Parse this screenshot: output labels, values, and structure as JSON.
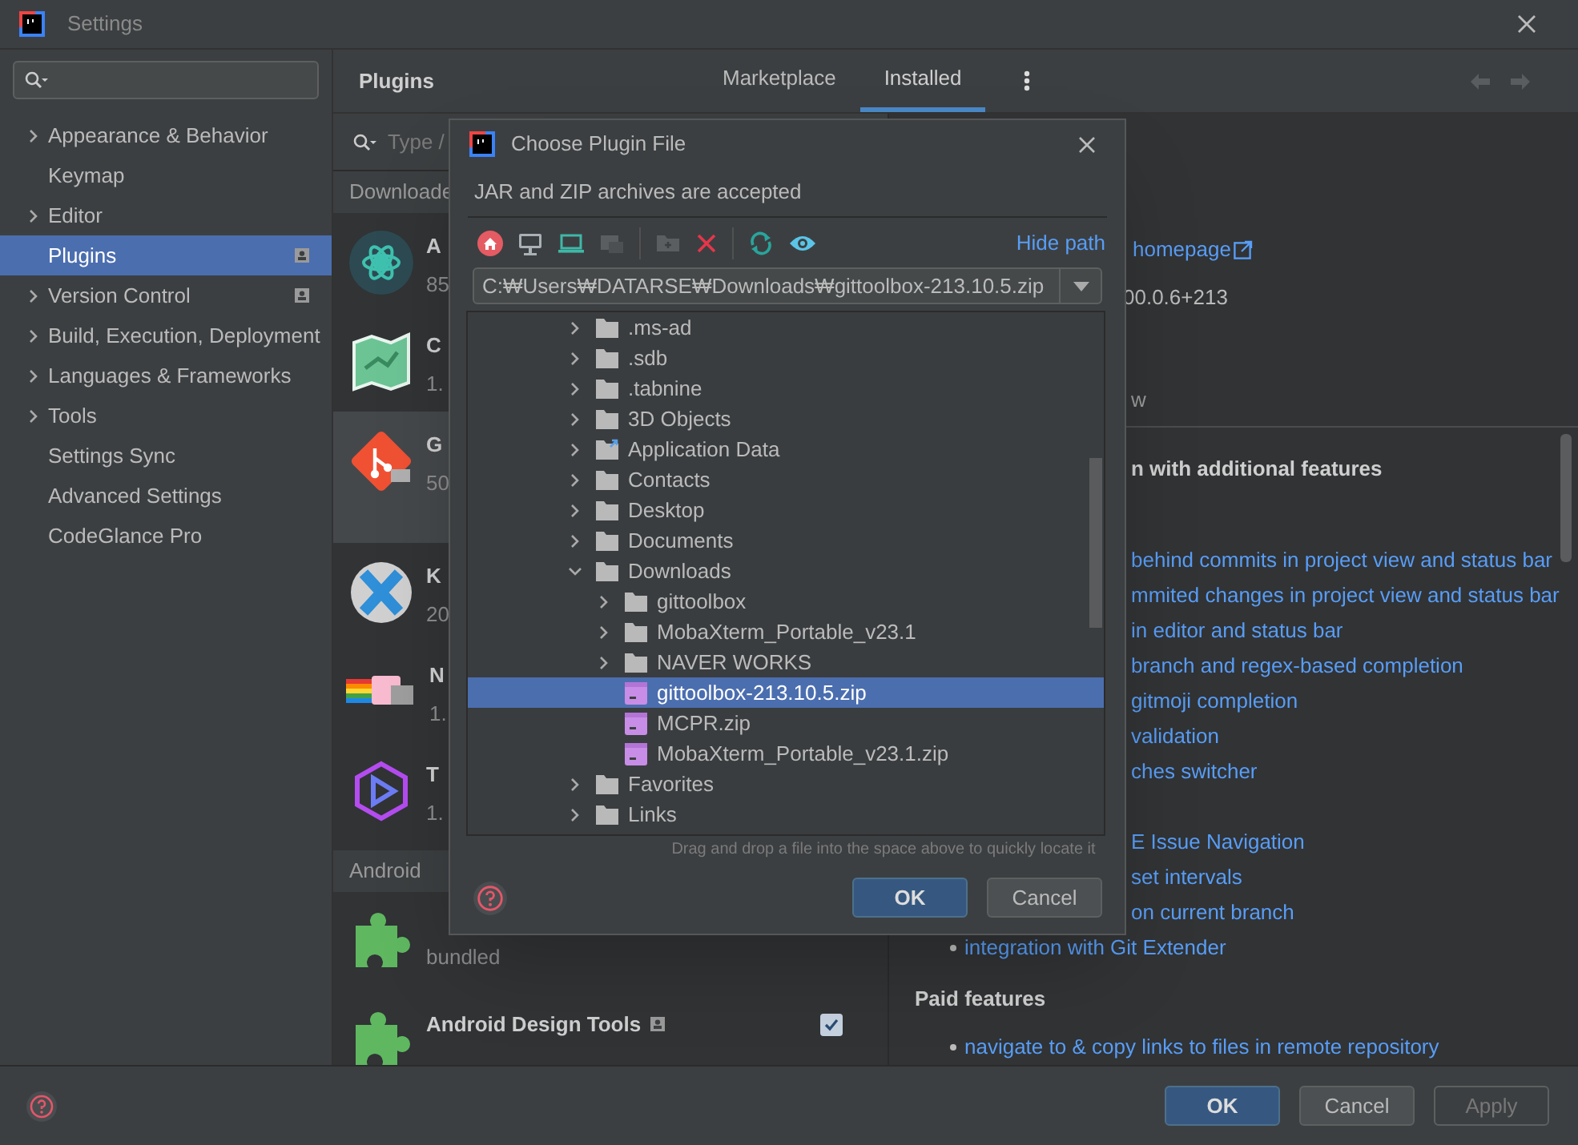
{
  "window": {
    "title": "Settings"
  },
  "sidebar": {
    "items": [
      {
        "label": "Appearance & Behavior",
        "expandable": true,
        "selected": false,
        "badge": false
      },
      {
        "label": "Keymap",
        "expandable": false,
        "selected": false,
        "badge": false
      },
      {
        "label": "Editor",
        "expandable": true,
        "selected": false,
        "badge": false
      },
      {
        "label": "Plugins",
        "expandable": false,
        "selected": true,
        "badge": true
      },
      {
        "label": "Version Control",
        "expandable": true,
        "selected": false,
        "badge": true
      },
      {
        "label": "Build, Execution, Deployment",
        "expandable": true,
        "selected": false,
        "badge": false
      },
      {
        "label": "Languages & Frameworks",
        "expandable": true,
        "selected": false,
        "badge": false
      },
      {
        "label": "Tools",
        "expandable": true,
        "selected": false,
        "badge": false
      },
      {
        "label": "Settings Sync",
        "expandable": false,
        "selected": false,
        "badge": false
      },
      {
        "label": "Advanced Settings",
        "expandable": false,
        "selected": false,
        "badge": false
      },
      {
        "label": "CodeGlance Pro",
        "expandable": false,
        "selected": false,
        "badge": false
      }
    ]
  },
  "plugins": {
    "title": "Plugins",
    "tabs": [
      {
        "label": "Marketplace",
        "selected": false
      },
      {
        "label": "Installed",
        "selected": true
      }
    ]
  },
  "plugin_list": {
    "search_placeholder": "Type /",
    "groups": [
      {
        "title": "Downloade",
        "plugins": [
          {
            "kind": "atom",
            "name": "A",
            "version": "85",
            "selected": false
          },
          {
            "kind": "map",
            "name": "C",
            "version": "1.",
            "selected": false
          },
          {
            "kind": "git",
            "name": "G",
            "version": "50",
            "selected": true
          },
          {
            "kind": "x",
            "name": "K",
            "version": "20",
            "selected": false
          },
          {
            "kind": "cat",
            "name": "N",
            "version": "1.",
            "selected": false
          },
          {
            "kind": "hex",
            "name": "T",
            "version": "1.",
            "selected": false
          }
        ]
      },
      {
        "title": "Android",
        "plugins": [
          {
            "kind": "puzzle",
            "version": "bundled",
            "selected": false
          },
          {
            "kind": "puzzle",
            "name": "Android Design Tools",
            "badge": true,
            "checked": true,
            "selected": false
          }
        ]
      }
    ]
  },
  "detail": {
    "homepage": "homepage",
    "version": "00.0.6+213",
    "tab_fragment": "w",
    "heading": "n with additional features",
    "features": [
      {
        "text": "behind commits in project view and status bar",
        "bullet": false
      },
      {
        "text": "mmited changes in project view and status bar",
        "bullet": false
      },
      {
        "text": "in editor and status bar",
        "bullet": false
      },
      {
        "text": "branch and regex-based completion",
        "bullet": false
      },
      {
        "text": "gitmoji completion",
        "bullet": false
      },
      {
        "text": "validation",
        "bullet": false
      },
      {
        "text": "ches switcher",
        "bullet": false
      }
    ],
    "more_features": [
      {
        "text": "E Issue Navigation",
        "bullet": false
      },
      {
        "text": "set intervals",
        "bullet": false
      },
      {
        "text": "on current branch",
        "bullet": false
      },
      {
        "text": "integration with Git Extender",
        "bullet": true
      }
    ],
    "paid_heading": "Paid features",
    "paid_features": [
      {
        "text": "navigate to & copy links to files in remote repository",
        "bullet": true
      }
    ]
  },
  "dialog": {
    "title": "Choose Plugin File",
    "description": "JAR and ZIP archives are accepted",
    "hide_path": "Hide path",
    "path": "C:₩Users₩DATARSE₩Downloads₩gittoolbox-213.10.5.zip",
    "tree": [
      {
        "label": ".ms-ad",
        "kind": "folder",
        "expanded": false,
        "selected": false
      },
      {
        "label": ".sdb",
        "kind": "folder",
        "expanded": false,
        "selected": false
      },
      {
        "label": ".tabnine",
        "kind": "folder",
        "expanded": false,
        "selected": false
      },
      {
        "label": "3D Objects",
        "kind": "folder",
        "expanded": false,
        "selected": false
      },
      {
        "label": "Application Data",
        "kind": "folder_link",
        "expanded": false,
        "selected": false
      },
      {
        "label": "Contacts",
        "kind": "folder",
        "expanded": false,
        "selected": false
      },
      {
        "label": "Desktop",
        "kind": "folder",
        "expanded": false,
        "selected": false
      },
      {
        "label": "Documents",
        "kind": "folder",
        "expanded": false,
        "selected": false
      },
      {
        "label": "Downloads",
        "kind": "folder",
        "expanded": true,
        "selected": false,
        "children": [
          {
            "label": "gittoolbox",
            "kind": "folder",
            "expanded": false,
            "selected": false
          },
          {
            "label": "MobaXterm_Portable_v23.1",
            "kind": "folder",
            "expanded": false,
            "selected": false
          },
          {
            "label": "NAVER WORKS",
            "kind": "folder",
            "expanded": false,
            "selected": false
          },
          {
            "label": "gittoolbox-213.10.5.zip",
            "kind": "file",
            "selected": true
          },
          {
            "label": "MCPR.zip",
            "kind": "file",
            "selected": false
          },
          {
            "label": "MobaXterm_Portable_v23.1.zip",
            "kind": "file",
            "selected": false
          }
        ]
      },
      {
        "label": "Favorites",
        "kind": "folder",
        "expanded": false,
        "selected": false
      },
      {
        "label": "Links",
        "kind": "folder",
        "expanded": false,
        "selected": false
      }
    ],
    "hint": "Drag and drop a file into the space above to quickly locate it",
    "buttons": [
      {
        "label": "OK",
        "kind": "primary"
      },
      {
        "label": "Cancel",
        "kind": "secondary"
      }
    ]
  },
  "buttons": [
    {
      "label": "OK",
      "kind": "primary"
    },
    {
      "label": "Cancel",
      "kind": "secondary"
    },
    {
      "label": "Apply",
      "kind": "disabled"
    }
  ]
}
